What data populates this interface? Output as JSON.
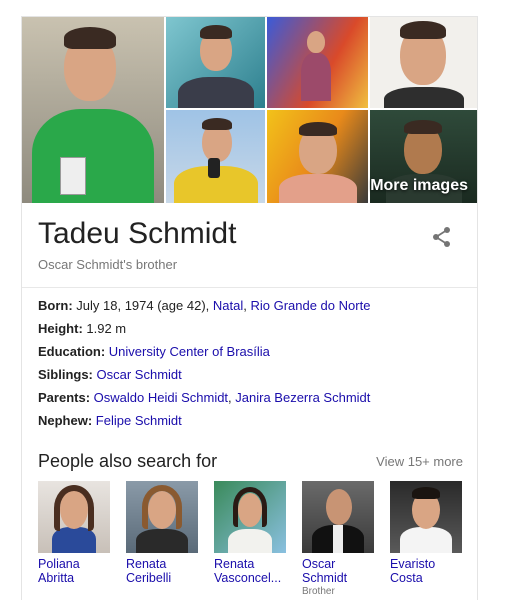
{
  "images": {
    "more_label": "More images"
  },
  "entity": {
    "name": "Tadeu Schmidt",
    "subtitle": "Oscar Schmidt's brother"
  },
  "facts": [
    {
      "label": "Born:",
      "text": " July 18, 1974 (age 42), ",
      "links": [
        "Natal",
        "Rio Grande do Norte"
      ]
    },
    {
      "label": "Height:",
      "text": " 1.92 m"
    },
    {
      "label": "Education:",
      "links": [
        "University Center of Brasília"
      ]
    },
    {
      "label": "Siblings:",
      "links": [
        "Oscar Schmidt"
      ]
    },
    {
      "label": "Parents:",
      "links": [
        "Oswaldo Heidi Schmidt",
        "Janira Bezerra Schmidt"
      ]
    },
    {
      "label": "Nephew:",
      "links": [
        "Felipe Schmidt"
      ]
    }
  ],
  "people_also_search": {
    "title": "People also search for",
    "more": "View 15+ more",
    "people": [
      {
        "name1": "Poliana",
        "name2": "Abritta",
        "sub": ""
      },
      {
        "name1": "Renata",
        "name2": "Ceribelli",
        "sub": ""
      },
      {
        "name1": "Renata",
        "name2": "Vasconcel...",
        "sub": ""
      },
      {
        "name1": "Oscar",
        "name2": "Schmidt",
        "sub": "Brother"
      },
      {
        "name1": "Evaristo",
        "name2": "Costa",
        "sub": ""
      }
    ]
  },
  "colors": {
    "link": "#1a0dab",
    "muted": "#777777",
    "text": "#222222"
  },
  "icons": {
    "share": "share-icon"
  }
}
